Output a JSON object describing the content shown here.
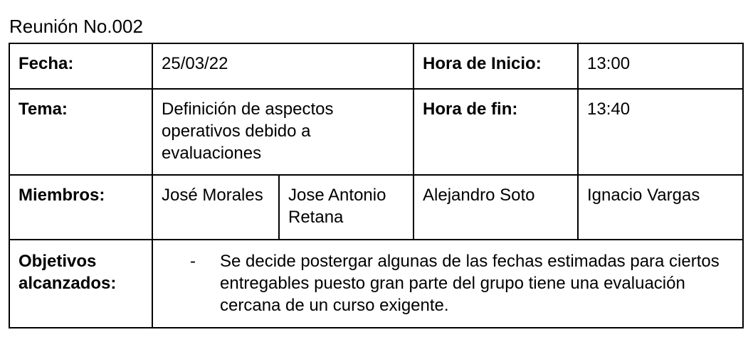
{
  "doc_title": "Reunión No.002",
  "table": {
    "fecha_label": "Fecha:",
    "fecha_value": "25/03/22",
    "hora_inicio_label": "Hora de Inicio:",
    "hora_inicio_value": "13:00",
    "tema_label": "Tema:",
    "tema_value": "Definición de aspectos operativos debido a evaluaciones",
    "hora_fin_label": "Hora de fin:",
    "hora_fin_value": "13:40",
    "miembros_label": "Miembros:",
    "miembros": [
      "José Morales",
      "Jose Antonio Retana",
      "Alejandro Soto",
      "Ignacio Vargas"
    ],
    "objetivos_label": "Objetivos alcanzados:",
    "objetivos_bullet": "-",
    "objetivos_text": "Se decide postergar algunas de las fechas estimadas para ciertos entregables puesto gran parte del grupo tiene una evaluación cercana de un curso exigente."
  }
}
